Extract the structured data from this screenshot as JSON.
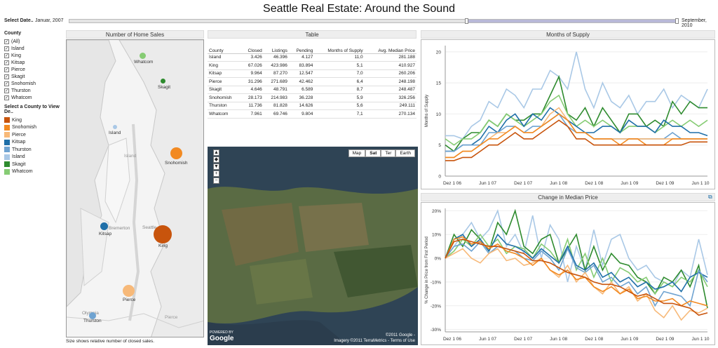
{
  "title": "Seattle Real Estate: Around the Sound",
  "date_filter": {
    "label": "Select Date..",
    "start": "Januar, 2007",
    "end": "September, 2010"
  },
  "county_filter": {
    "heading": "County",
    "items": [
      "(All)",
      "Island",
      "King",
      "Kitsap",
      "Pierce",
      "Skagit",
      "Snohomish",
      "Thurston",
      "Whatcom"
    ]
  },
  "highlight": {
    "heading": "Select a County to View De..",
    "items": [
      {
        "label": "King",
        "color": "#c8540c"
      },
      {
        "label": "Snohomish",
        "color": "#f28a22"
      },
      {
        "label": "Pierce",
        "color": "#f7b979"
      },
      {
        "label": "Kitsap",
        "color": "#1f6fa8"
      },
      {
        "label": "Thurston",
        "color": "#6fa3d1"
      },
      {
        "label": "Island",
        "color": "#a9c8e6"
      },
      {
        "label": "Skagit",
        "color": "#2e8b2e"
      },
      {
        "label": "Whatcom",
        "color": "#86cc74"
      }
    ]
  },
  "map_panel": {
    "title": "Number of Home Sales",
    "caption": "Size shows relative number of closed sales.",
    "labels": {
      "whatcom": "Whatcom",
      "skagit": "Skagit",
      "island": "Island",
      "snohomish": "Snohomish",
      "kitsap": "Kitsap",
      "king": "King",
      "pierce": "Pierce",
      "thurston": "Thurston",
      "seattle": "Seattle",
      "bremerton": "Bremerton",
      "olympia": "Olympia",
      "pierce_region": "Pierce",
      "island_region": "Island"
    }
  },
  "table": {
    "title": "Table",
    "columns": [
      "County",
      "Closed",
      "Listings",
      "Pending",
      "Months of Supply",
      "Avg. Median Price"
    ],
    "rows": [
      [
        "Island",
        "3.426",
        "46.396",
        "4.127",
        "11,0",
        "281.188"
      ],
      [
        "King",
        "67.026",
        "423.986",
        "83.894",
        "5,1",
        "410.927"
      ],
      [
        "Kitsap",
        "9.964",
        "87.270",
        "12.547",
        "7,0",
        "260.206"
      ],
      [
        "Pierce",
        "31.296",
        "271.689",
        "42.462",
        "6,4",
        "248.198"
      ],
      [
        "Skagit",
        "4.646",
        "48.791",
        "6.589",
        "8,7",
        "248.487"
      ],
      [
        "Snohomish",
        "28.173",
        "214.983",
        "36.228",
        "5,9",
        "326.256"
      ],
      [
        "Thurston",
        "11.736",
        "81.828",
        "14.626",
        "5,6",
        "249.111"
      ],
      [
        "Whatcom",
        "7.961",
        "69.746",
        "9.804",
        "7,1",
        "270.134"
      ]
    ]
  },
  "satellite": {
    "buttons": [
      "Map",
      "Sat",
      "Ter",
      "Earth"
    ],
    "active": "Sat",
    "powered": "POWERED BY",
    "brand": "Google",
    "copyright1": "©2011 Google -",
    "copyright2": "Imagery ©2011 TerraMetrics - Terms of Use"
  },
  "chart_data": [
    {
      "type": "line",
      "title": "Months of Supply",
      "ylabel": "Months of Supply",
      "x_ticks": [
        "Dez 1 06",
        "Jun 1 07",
        "Dez 1 07",
        "Jun 1 08",
        "Dez 1 08",
        "Jun 1 09",
        "Dez 1 09",
        "Jun 1 10"
      ],
      "y_ticks": [
        "20",
        "15",
        "10",
        "5",
        "0"
      ],
      "ylim": [
        0,
        21
      ],
      "series": [
        {
          "name": "Island",
          "color": "#a9c8e6",
          "values": [
            6.5,
            6.5,
            6,
            8,
            9,
            12,
            11,
            14,
            13,
            11,
            14,
            14,
            17,
            16,
            14,
            20,
            14,
            11,
            15,
            12,
            11,
            13,
            10,
            12,
            12,
            14,
            11,
            13,
            12,
            11,
            14
          ]
        },
        {
          "name": "Skagit",
          "color": "#2e8b2e",
          "values": [
            5,
            4,
            6,
            7,
            7,
            9,
            8,
            10,
            9,
            9,
            10,
            10,
            13,
            16,
            10,
            9,
            11,
            8,
            11,
            9,
            7,
            10,
            10,
            8,
            9,
            8,
            12,
            10,
            12,
            11,
            11
          ]
        },
        {
          "name": "Whatcom",
          "color": "#86cc74",
          "values": [
            6,
            5,
            6,
            6,
            7,
            9,
            8,
            10,
            9,
            8,
            9,
            10,
            12,
            13,
            10,
            8,
            9,
            8,
            9,
            8,
            7,
            8,
            8,
            8,
            7,
            8,
            9,
            8,
            9,
            8,
            9
          ]
        },
        {
          "name": "Kitsap",
          "color": "#1f6fa8",
          "values": [
            4,
            4,
            5,
            5,
            6,
            8,
            7,
            9,
            10,
            8,
            10,
            9,
            11,
            10,
            9,
            8,
            7,
            7,
            8,
            8,
            7,
            9,
            8,
            8,
            7,
            9,
            8,
            8,
            7,
            7,
            6.5
          ]
        },
        {
          "name": "Thurston",
          "color": "#6fa3d1",
          "values": [
            4,
            4,
            5,
            5,
            5,
            7,
            7,
            8,
            8,
            7,
            8,
            8,
            9,
            10,
            8,
            7,
            7,
            6,
            6,
            6,
            6,
            6,
            6,
            6,
            6,
            6,
            7,
            6,
            6,
            6,
            6
          ]
        },
        {
          "name": "Pierce",
          "color": "#f7b979",
          "values": [
            3,
            3,
            4,
            4,
            5,
            6,
            7,
            7,
            8,
            7,
            7,
            8,
            10,
            11,
            9,
            7,
            7,
            6,
            6,
            6,
            6,
            6,
            6,
            6,
            6,
            6,
            6,
            6,
            6,
            6,
            6
          ]
        },
        {
          "name": "Snohomish",
          "color": "#f28a22",
          "values": [
            3,
            3,
            4,
            4,
            5,
            6,
            6,
            7,
            8,
            7,
            7,
            8,
            9,
            10,
            9,
            7,
            7,
            6,
            6,
            6,
            5,
            6,
            6,
            5,
            5,
            5,
            6,
            6,
            6,
            6,
            6
          ]
        },
        {
          "name": "King",
          "color": "#c8540c",
          "values": [
            2.5,
            2.5,
            3,
            3,
            4,
            5,
            5,
            6,
            7,
            6,
            6,
            7,
            8,
            9,
            8,
            6,
            6,
            5,
            5,
            5,
            5,
            5,
            5,
            5,
            5,
            5,
            5,
            5,
            5.5,
            5.5,
            5.5
          ]
        }
      ]
    },
    {
      "type": "line",
      "title": "Change in Median Price",
      "ylabel": "% Change in Price from First Period",
      "x_ticks": [
        "Dez 1 06",
        "Jun 1 07",
        "Dez 1 07",
        "Jun 1 08",
        "Dez 1 08",
        "Jun 1 09",
        "Dez 1 09",
        "Jun 1 10"
      ],
      "y_ticks": [
        "20%",
        "10%",
        "0%",
        "-10%",
        "-20%",
        "-30%"
      ],
      "ylim": [
        -31,
        21
      ],
      "series": [
        {
          "name": "Island",
          "color": "#a9c8e6",
          "values": [
            0,
            5,
            10,
            15,
            8,
            12,
            20,
            5,
            10,
            2,
            18,
            0,
            14,
            8,
            -10,
            5,
            -5,
            12,
            -3,
            8,
            10,
            0,
            -5,
            -3,
            -8,
            -10,
            -12,
            -5,
            -8,
            8,
            -7
          ]
        },
        {
          "name": "Skagit",
          "color": "#2e8b2e",
          "values": [
            0,
            10,
            5,
            12,
            8,
            3,
            15,
            10,
            20,
            5,
            2,
            8,
            10,
            -2,
            4,
            10,
            -5,
            5,
            -5,
            2,
            -2,
            -3,
            -8,
            -10,
            -15,
            -8,
            -10,
            -5,
            -12,
            -3,
            -21
          ]
        },
        {
          "name": "Whatcom",
          "color": "#86cc74",
          "values": [
            0,
            3,
            8,
            5,
            10,
            5,
            8,
            2,
            5,
            4,
            0,
            6,
            3,
            -2,
            8,
            -5,
            2,
            -8,
            0,
            -10,
            -4,
            -6,
            -10,
            -8,
            -15,
            -10,
            -12,
            -8,
            -10,
            -5,
            -12
          ]
        },
        {
          "name": "Kitsap",
          "color": "#1f6fa8",
          "values": [
            0,
            8,
            10,
            5,
            8,
            3,
            10,
            6,
            5,
            3,
            0,
            4,
            1,
            -2,
            5,
            -3,
            -5,
            -2,
            -8,
            -6,
            -10,
            -8,
            -12,
            -10,
            -13,
            -12,
            -10,
            -14,
            -8,
            -6,
            -8
          ]
        },
        {
          "name": "Thurston",
          "color": "#6fa3d1",
          "values": [
            0,
            5,
            6,
            3,
            7,
            2,
            5,
            4,
            3,
            0,
            -1,
            3,
            0,
            -5,
            4,
            -4,
            -6,
            -3,
            -10,
            -8,
            -12,
            -10,
            -15,
            -12,
            -20,
            -14,
            -15,
            -16,
            -20,
            -5,
            -10
          ]
        },
        {
          "name": "Pierce",
          "color": "#f7b979",
          "values": [
            0,
            2,
            4,
            0,
            -2,
            2,
            4,
            -1,
            0,
            -3,
            -2,
            0,
            -5,
            -8,
            -3,
            -10,
            -6,
            -12,
            -15,
            -10,
            -15,
            -12,
            -18,
            -15,
            -22,
            -25,
            -20,
            -26,
            -22,
            -23,
            -21
          ]
        },
        {
          "name": "Snohomish",
          "color": "#f28a22",
          "values": [
            0,
            8,
            9,
            6,
            7,
            4,
            6,
            3,
            2,
            0,
            -3,
            0,
            -5,
            -7,
            -5,
            -9,
            -8,
            -12,
            -14,
            -12,
            -15,
            -13,
            -17,
            -16,
            -18,
            -18,
            -17,
            -20,
            -18,
            -19,
            -20
          ]
        },
        {
          "name": "King",
          "color": "#c8540c",
          "values": [
            0,
            7,
            8,
            7,
            6,
            5,
            5,
            4,
            3,
            2,
            -1,
            -1,
            -2,
            -4,
            -6,
            -7,
            -8,
            -10,
            -11,
            -11,
            -12,
            -14,
            -16,
            -15,
            -17,
            -19,
            -19,
            -20,
            -21,
            -24,
            -23
          ]
        }
      ]
    }
  ]
}
